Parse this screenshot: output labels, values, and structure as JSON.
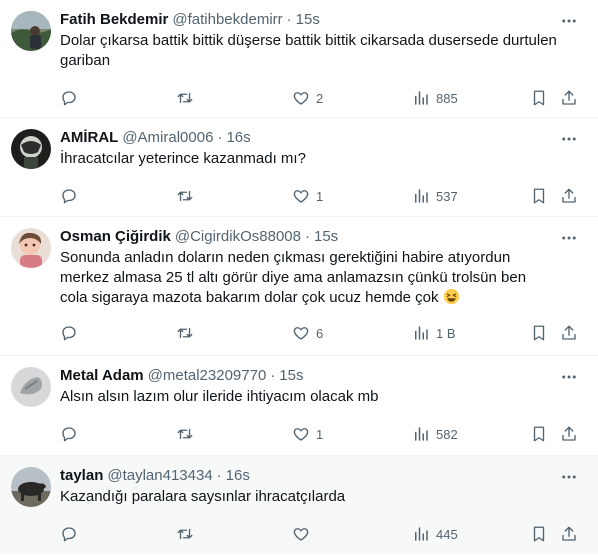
{
  "tweets": [
    {
      "name": "Fatih Bekdemir",
      "handle": "@fatihbekdemirr",
      "time": "15s",
      "text": "Dolar çıkarsa battik bittik düşerse battik bittik cikarsada dusersede durtulen gariban",
      "replies": "",
      "retweets": "",
      "likes": "2",
      "views": "885"
    },
    {
      "name": "AMİRAL",
      "handle": "@Amiral0006",
      "time": "16s",
      "text": "İhracatcılar yeterince kazanmadı mı?",
      "replies": "",
      "retweets": "",
      "likes": "1",
      "views": "537"
    },
    {
      "name": "Osman Çiğirdik",
      "handle": "@CigirdikOs88008",
      "time": "15s",
      "text": "Sonunda anladın doların neden çıkması gerektiğini habire atıyordun merkez almasa 25 tl altı görür diye ama anlamazsın çünkü trolsün ben cola sigaraya mazota bakarım dolar çok ucuz hemde çok",
      "replies": "",
      "retweets": "",
      "likes": "6",
      "views": "1 B"
    },
    {
      "name": "Metal Adam",
      "handle": "@metal23209770",
      "time": "15s",
      "text": "Alsın alsın lazım olur ileride ihtiyacım olacak mb",
      "replies": "",
      "retweets": "",
      "likes": "1",
      "views": "582"
    },
    {
      "name": "taylan",
      "handle": "@taylan413434",
      "time": "16s",
      "text": "Kazandığı paralara saysınlar ihracatçılarda",
      "replies": "",
      "retweets": "",
      "likes": "",
      "views": "445"
    }
  ],
  "icons": {
    "reply": "reply-icon",
    "retweet": "retweet-icon",
    "like": "heart-icon",
    "views": "views-icon",
    "bookmark": "bookmark-icon",
    "share": "share-icon",
    "more": "more-icon"
  },
  "colors": {
    "text": "#0f1419",
    "secondary": "#536471",
    "divider": "#eff3f4",
    "highlight_bg": "#f7f9f9"
  }
}
